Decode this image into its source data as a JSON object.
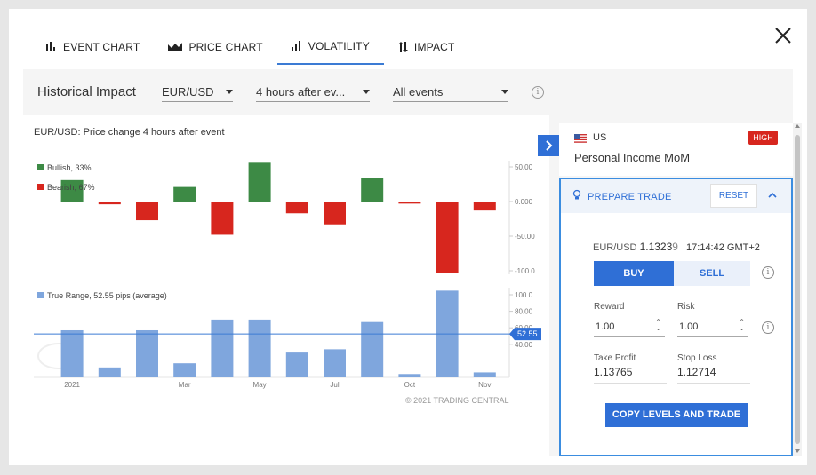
{
  "tabs": [
    {
      "label": "EVENT CHART",
      "icon": "bar-chart-icon",
      "active": false
    },
    {
      "label": "PRICE CHART",
      "icon": "area-chart-icon",
      "active": false
    },
    {
      "label": "VOLATILITY",
      "icon": "volatility-icon",
      "active": true
    },
    {
      "label": "IMPACT",
      "icon": "up-down-arrows-icon",
      "active": false
    }
  ],
  "filters": {
    "title": "Historical Impact",
    "pair": "EUR/USD",
    "time": "4 hours after ev...",
    "events": "All events"
  },
  "chart": {
    "title_pair": "EUR/USD:",
    "title_text": " Price change 4 hours after event",
    "copyright": "© 2021 TRADING CENTRAL"
  },
  "chart_data": [
    {
      "type": "bar",
      "title": "EUR/USD: Price change 4 hours after event",
      "series": [
        {
          "name": "Bullish, 33%",
          "color": "#3d8a45",
          "values": [
            31,
            null,
            null,
            21,
            null,
            56,
            null,
            null,
            34,
            null,
            null,
            null
          ]
        },
        {
          "name": "Bearish, 67%",
          "color": "#d7261e",
          "values": [
            null,
            -4,
            -27,
            null,
            -48,
            null,
            -17,
            -33,
            null,
            -3,
            -103,
            -13
          ]
        }
      ],
      "yticks": [
        "50.00",
        "0.000",
        "-50.00",
        "-100.0"
      ],
      "ylim": [
        -105,
        60
      ],
      "grid": false,
      "legend_position": "top-left"
    },
    {
      "type": "bar",
      "series": [
        {
          "name": "True Range, 52.55 pips (average)",
          "color": "#7fa6dd",
          "values": [
            57,
            12,
            57,
            17,
            70,
            70,
            30,
            34,
            67,
            4,
            105,
            6
          ]
        }
      ],
      "average": 52.55,
      "average_label": "52.55",
      "x_tick_labels": [
        "2021",
        "Mar",
        "May",
        "Jul",
        "Oct",
        "Nov"
      ],
      "yticks": [
        "100.0",
        "80.00",
        "60.00",
        "40.00"
      ],
      "ylim": [
        0,
        105
      ],
      "grid": false,
      "legend_position": "top-left"
    }
  ],
  "event": {
    "country": "US",
    "impact": "HIGH",
    "name": "Personal Income MoM"
  },
  "trade": {
    "title": "PREPARE TRADE",
    "reset": "RESET",
    "pair": "EUR/USD",
    "price_main": "1.1323",
    "price_last": "9",
    "time": "17:14:42 GMT+2",
    "buy": "BUY",
    "sell": "SELL",
    "reward_label": "Reward",
    "reward_value": "1.00",
    "risk_label": "Risk",
    "risk_value": "1.00",
    "take_profit_label": "Take Profit",
    "take_profit_value": "1.13765",
    "stop_loss_label": "Stop Loss",
    "stop_loss_value": "1.12714",
    "copy_button": "COPY LEVELS AND TRADE"
  },
  "colors": {
    "accent": "#2f6fd6",
    "bullish": "#3d8a45",
    "bearish": "#d7261e",
    "true_range": "#7fa6dd",
    "high_badge": "#d7261e"
  }
}
